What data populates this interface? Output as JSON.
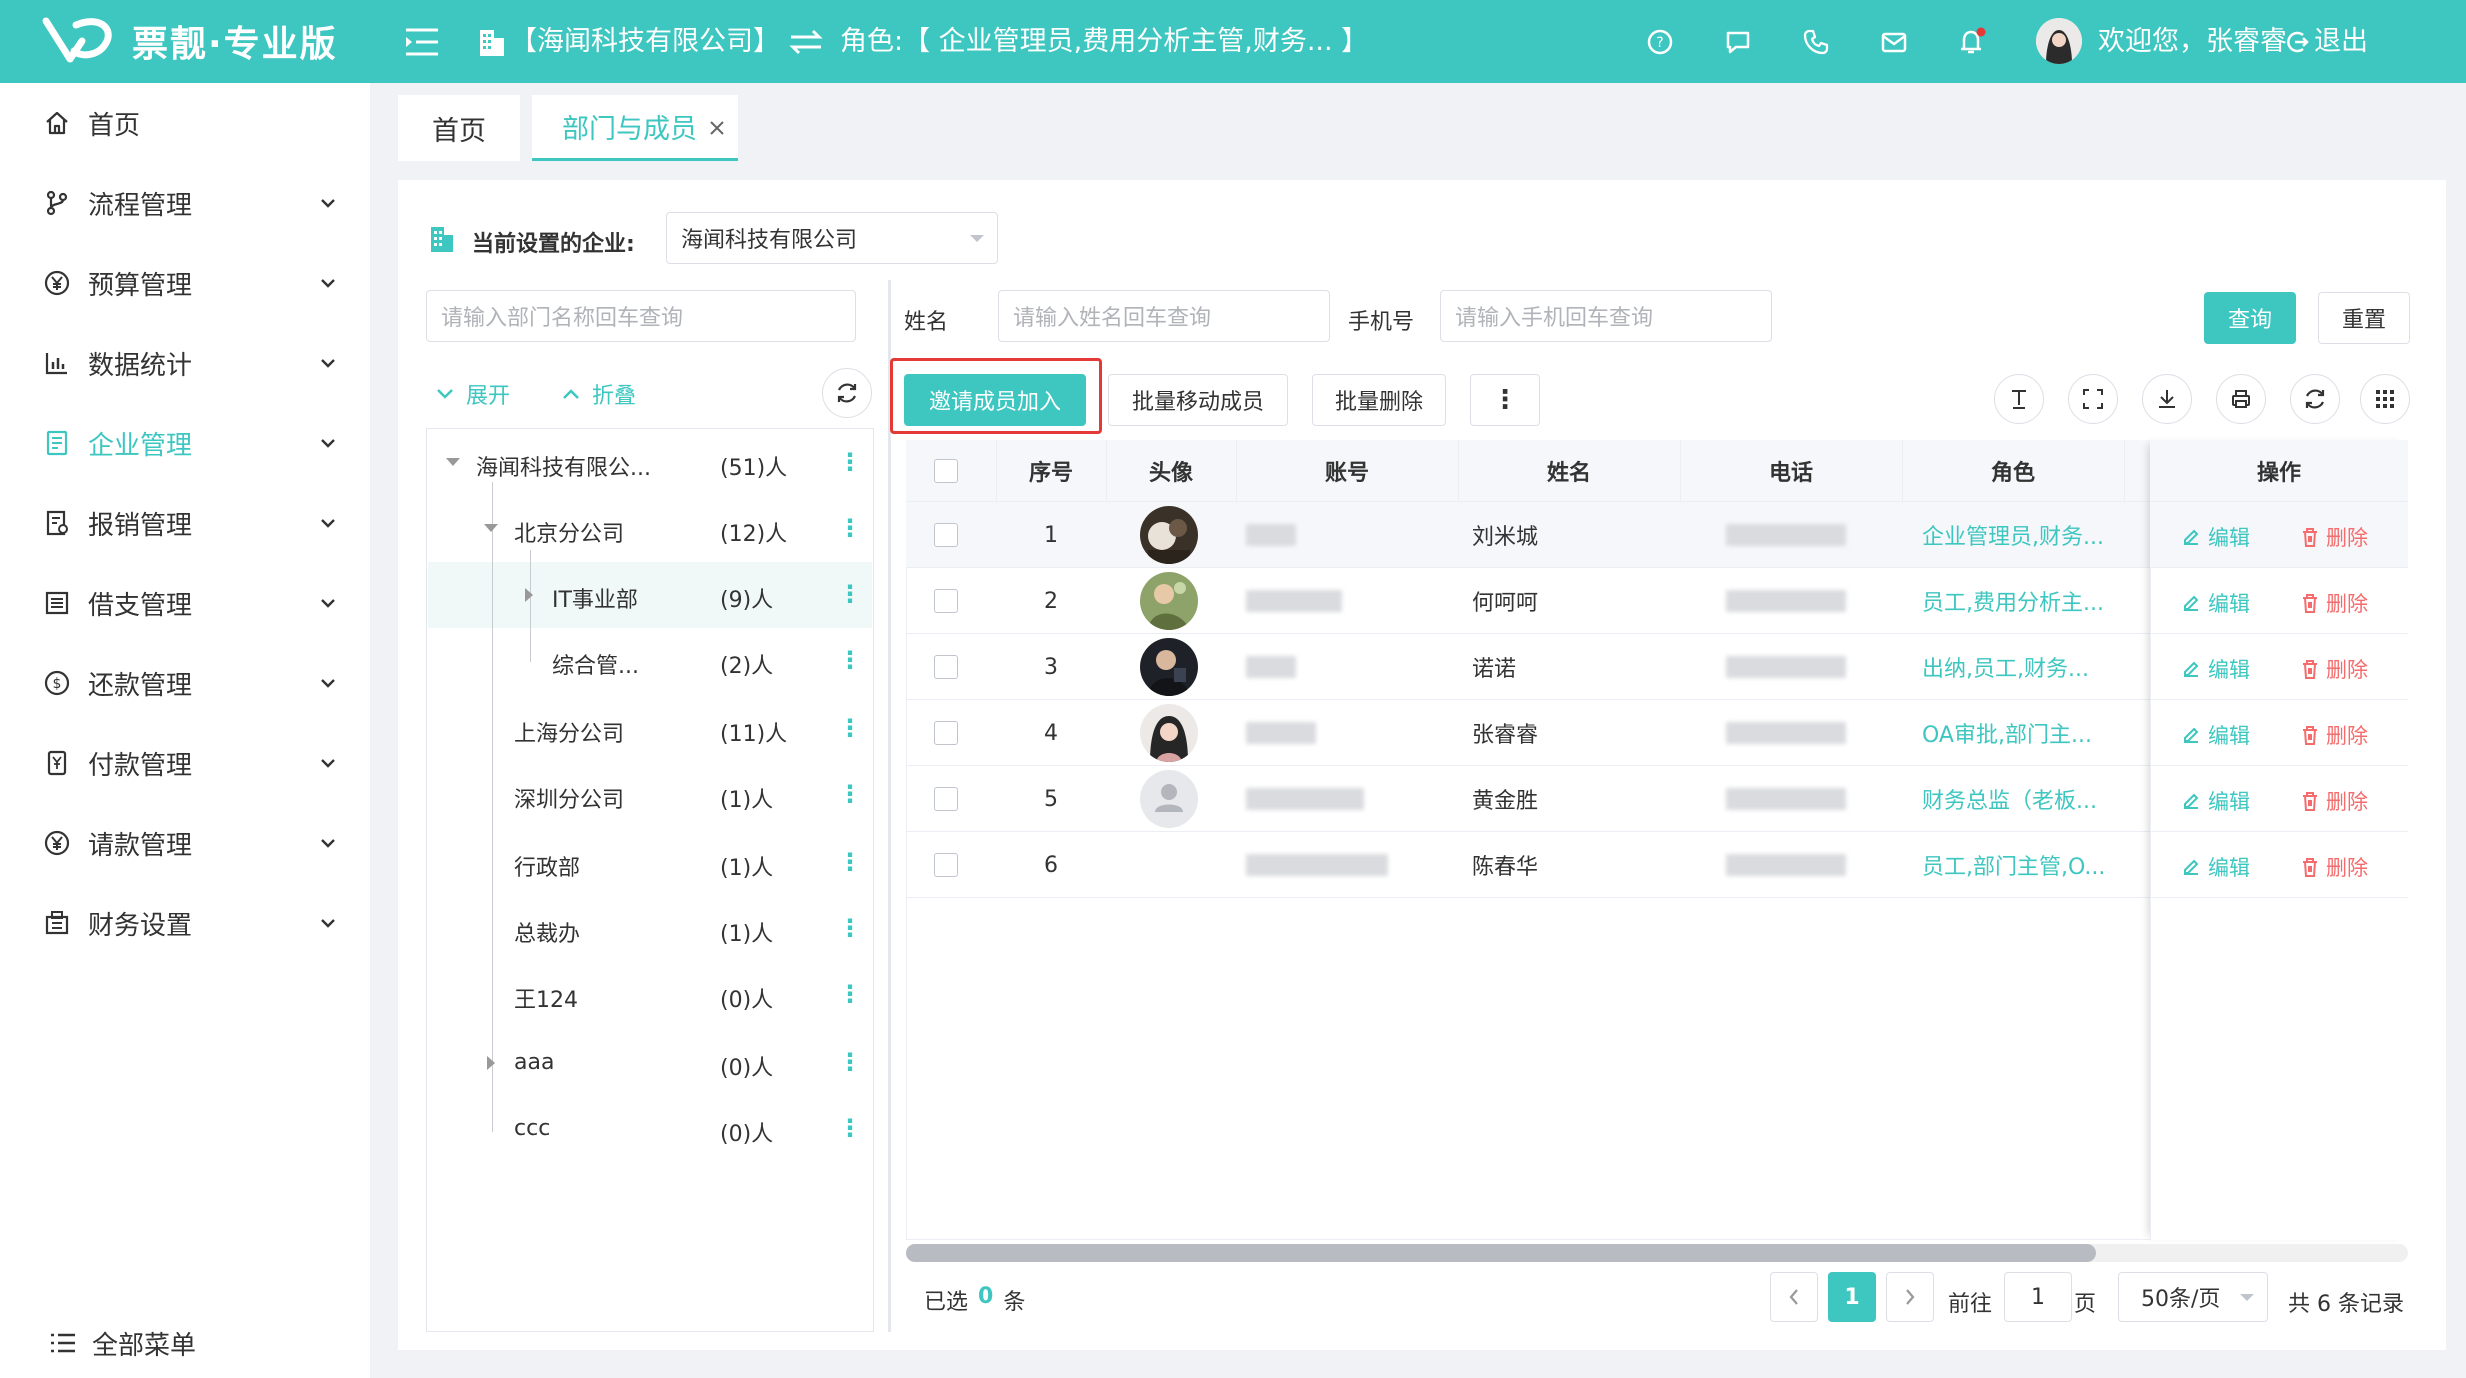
{
  "header": {
    "logo_text": "票靓·专业版",
    "company": "【海闻科技有限公司】",
    "role": "角色:【 企业管理员,费用分析主管,财务... 】",
    "welcome": "欢迎您，张睿睿",
    "logout": "退出"
  },
  "sidebar": {
    "items": [
      {
        "label": "首页",
        "icon": "home-icon"
      },
      {
        "label": "流程管理",
        "icon": "branch-icon"
      },
      {
        "label": "预算管理",
        "icon": "yen-icon"
      },
      {
        "label": "数据统计",
        "icon": "bar-chart-icon"
      },
      {
        "label": "企业管理",
        "icon": "enterprise-icon"
      },
      {
        "label": "报销管理",
        "icon": "reimburse-icon"
      },
      {
        "label": "借支管理",
        "icon": "loan-icon"
      },
      {
        "label": "还款管理",
        "icon": "repay-icon"
      },
      {
        "label": "付款管理",
        "icon": "payment-icon"
      },
      {
        "label": "请款管理",
        "icon": "request-icon"
      },
      {
        "label": "财务设置",
        "icon": "finance-settings-icon"
      }
    ],
    "all_menu": "全部菜单"
  },
  "tabs": [
    {
      "label": "首页"
    },
    {
      "label": "部门与成员"
    }
  ],
  "filter": {
    "company_label": "当前设置的企业:",
    "company_value": "海闻科技有限公司",
    "dept_placeholder": "请输入部门名称回车查询",
    "name_label": "姓名",
    "name_placeholder": "请输入姓名回车查询",
    "phone_label": "手机号",
    "phone_placeholder": "请输入手机回车查询",
    "query": "查询",
    "reset": "重置",
    "expand": "展开",
    "collapse": "折叠"
  },
  "tree": [
    {
      "name": "海闻科技有限公...",
      "count": "(51)人"
    },
    {
      "name": "北京分公司",
      "count": "(12)人"
    },
    {
      "name": "IT事业部",
      "count": "(9)人"
    },
    {
      "name": "综合管...",
      "count": "(2)人"
    },
    {
      "name": "上海分公司",
      "count": "(11)人"
    },
    {
      "name": "深圳分公司",
      "count": "(1)人"
    },
    {
      "name": "行政部",
      "count": "(1)人"
    },
    {
      "name": "总裁办",
      "count": "(1)人"
    },
    {
      "name": "王124",
      "count": "(0)人"
    },
    {
      "name": "aaa",
      "count": "(0)人"
    },
    {
      "name": "ccc",
      "count": "(0)人"
    }
  ],
  "actions": {
    "invite": "邀请成员加入",
    "batch_move": "批量移动成员",
    "batch_delete": "批量删除",
    "more": "⋮"
  },
  "table": {
    "headers": {
      "index": "序号",
      "avatar": "头像",
      "account": "账号",
      "name": "姓名",
      "phone": "电话",
      "role": "角色",
      "ops": "操作"
    },
    "rows": [
      {
        "index": "1",
        "name": "刘米城",
        "role": "企业管理员,财务..."
      },
      {
        "index": "2",
        "name": "何呵呵",
        "role": "员工,费用分析主..."
      },
      {
        "index": "3",
        "name": "诺诺",
        "role": "出纳,员工,财务..."
      },
      {
        "index": "4",
        "name": "张睿睿",
        "role": "OA审批,部门主..."
      },
      {
        "index": "5",
        "name": "黄金胜",
        "role": "财务总监（老板..."
      },
      {
        "index": "6",
        "name": "陈春华",
        "role": "员工,部门主管,O..."
      }
    ],
    "edit": "编辑",
    "delete": "删除"
  },
  "footer": {
    "selected_prefix": "已选",
    "selected_count": "0",
    "selected_suffix": "条",
    "current_page": "1",
    "goto_label": "前往",
    "goto_value": "1",
    "page_suffix": "页",
    "page_size": "50条/页",
    "total": "共 6 条记录"
  },
  "colors": {
    "accent": "#3ec6c0",
    "danger": "#f56c6c",
    "highlight": "#e53935"
  }
}
